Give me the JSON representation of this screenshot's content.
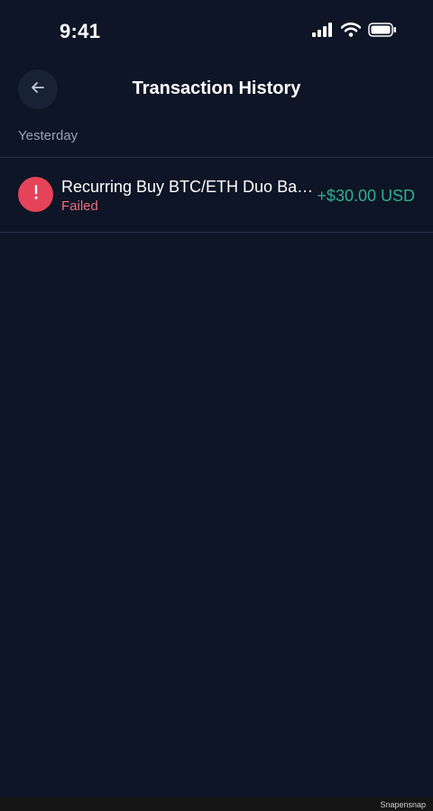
{
  "status_bar": {
    "time": "9:41",
    "icons": [
      "cellular-signal-icon",
      "wifi-icon",
      "battery-icon"
    ]
  },
  "header": {
    "title": "Transaction History",
    "back_icon": "arrow-left-icon"
  },
  "sections": [
    {
      "label": "Yesterday",
      "transactions": [
        {
          "title": "Recurring Buy BTC/ETH Duo Bas...",
          "status": "Failed",
          "amount": "+$30.00 USD",
          "icon": "exclamation-icon"
        }
      ]
    }
  ],
  "footer": {
    "watermark": "Snapensnap"
  },
  "colors": {
    "background": "#0d1526",
    "failed_icon_bg": "#e5435a",
    "failed_text": "#ef6d7e",
    "amount_text": "#2fb08f",
    "muted_text": "#98a2b3"
  }
}
